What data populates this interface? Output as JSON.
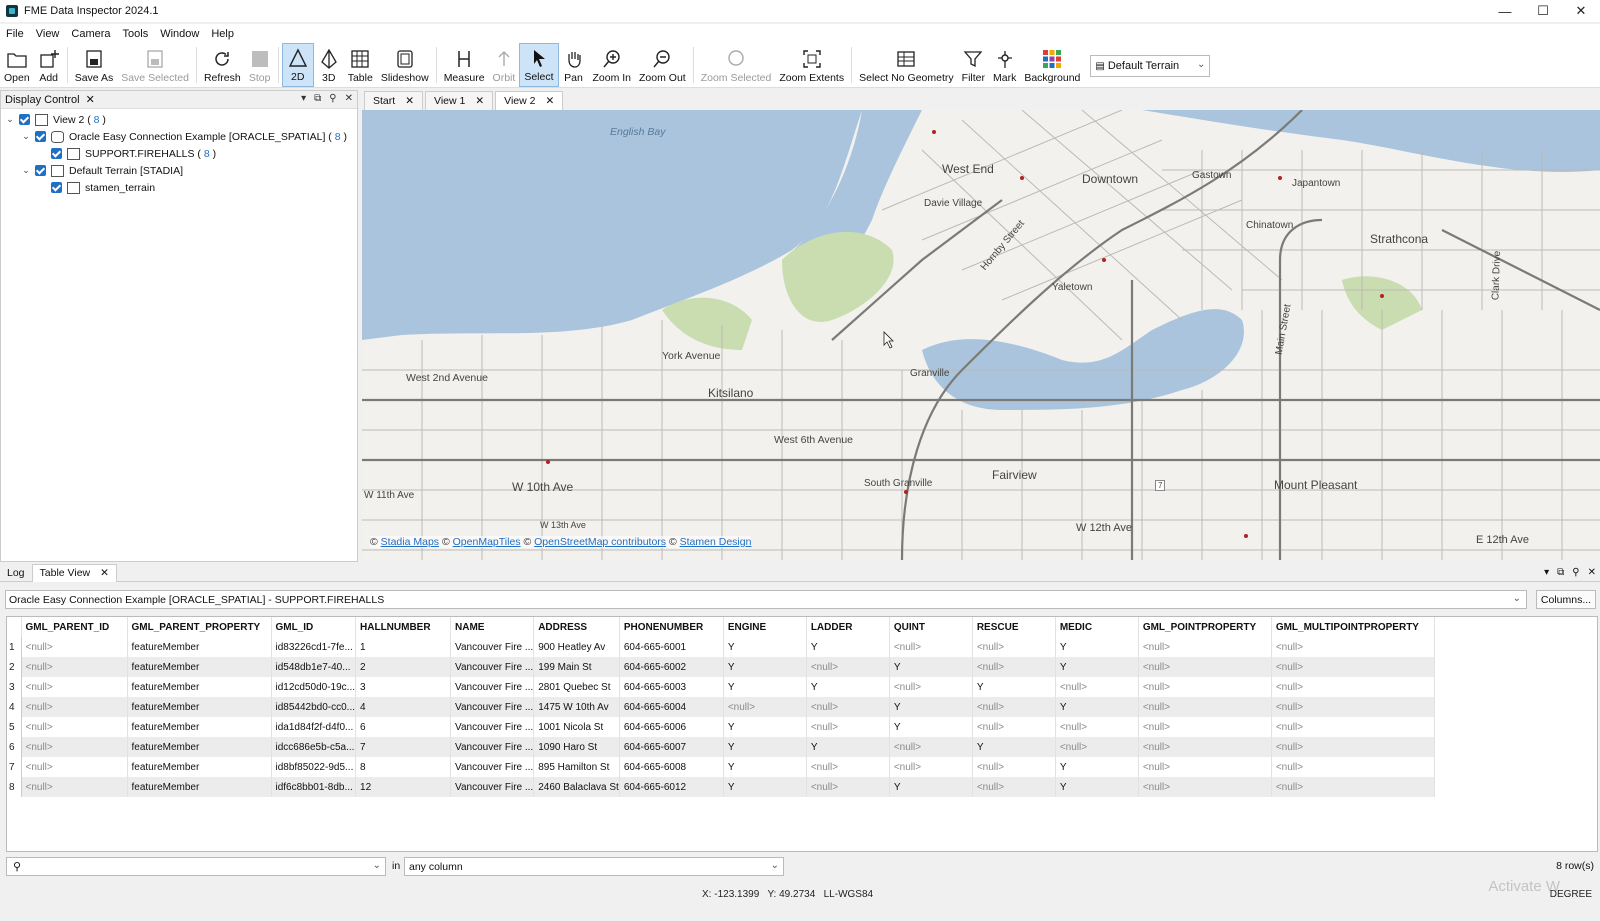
{
  "window": {
    "title": "FME Data Inspector 2024.1"
  },
  "menu": [
    "File",
    "View",
    "Camera",
    "Tools",
    "Window",
    "Help"
  ],
  "toolbar": {
    "buttons": [
      {
        "label": "Open",
        "icon": "folder-icon",
        "disabled": false
      },
      {
        "label": "Add",
        "icon": "add-layer-icon",
        "disabled": false
      },
      {
        "label": "Save As",
        "icon": "save-as-icon",
        "disabled": false
      },
      {
        "label": "Save Selected",
        "icon": "save-selected-icon",
        "disabled": true
      },
      {
        "label": "Refresh",
        "icon": "refresh-icon",
        "disabled": false
      },
      {
        "label": "Stop",
        "icon": "stop-icon",
        "disabled": true
      },
      {
        "label": "2D",
        "icon": "2d-icon",
        "disabled": false,
        "active": true
      },
      {
        "label": "3D",
        "icon": "3d-icon",
        "disabled": false
      },
      {
        "label": "Table",
        "icon": "table-icon",
        "disabled": false
      },
      {
        "label": "Slideshow",
        "icon": "slideshow-icon",
        "disabled": false
      },
      {
        "label": "Measure",
        "icon": "measure-icon",
        "disabled": false
      },
      {
        "label": "Orbit",
        "icon": "orbit-icon",
        "disabled": true
      },
      {
        "label": "Select",
        "icon": "select-arrow-icon",
        "disabled": false,
        "active": true
      },
      {
        "label": "Pan",
        "icon": "pan-hand-icon",
        "disabled": false
      },
      {
        "label": "Zoom In",
        "icon": "zoom-in-icon",
        "disabled": false
      },
      {
        "label": "Zoom Out",
        "icon": "zoom-out-icon",
        "disabled": false
      },
      {
        "label": "Zoom Selected",
        "icon": "zoom-selected-icon",
        "disabled": true
      },
      {
        "label": "Zoom Extents",
        "icon": "zoom-extents-icon",
        "disabled": false
      },
      {
        "label": "Select No Geometry",
        "icon": "select-no-geometry-icon",
        "disabled": false
      },
      {
        "label": "Filter",
        "icon": "filter-icon",
        "disabled": false
      },
      {
        "label": "Mark",
        "icon": "mark-icon",
        "disabled": false
      },
      {
        "label": "Background",
        "icon": "background-grid-icon",
        "disabled": false
      }
    ],
    "terrain_select": "Default Terrain"
  },
  "display_control": {
    "title": "Display Control",
    "tree": [
      {
        "label": "View 2",
        "count": "8",
        "level": 0,
        "icon": "view-icon"
      },
      {
        "label": "Oracle Easy Connection Example [ORACLE_SPATIAL]",
        "count": "8",
        "level": 1,
        "icon": "database-icon"
      },
      {
        "label": "SUPPORT.FIREHALLS",
        "count": "8",
        "level": 2,
        "icon": "table-layer-icon"
      },
      {
        "label": "Default Terrain [STADIA]",
        "count": "",
        "level": 1,
        "icon": "terrain-icon"
      },
      {
        "label": "stamen_terrain",
        "count": "",
        "level": 2,
        "icon": "table-layer-icon"
      }
    ]
  },
  "view_tabs": [
    "Start",
    "View 1",
    "View 2"
  ],
  "map": {
    "labels": [
      "English Bay",
      "West End",
      "Downtown",
      "Davie Village",
      "Gastown",
      "Japantown",
      "Chinatown",
      "Strathcona",
      "Hornby Street",
      "Yaletown",
      "York Avenue",
      "West 2nd Avenue",
      "Kitsilano",
      "Granville",
      "West 6th Avenue",
      "Fairview",
      "South Granville",
      "W 10th Ave",
      "W 11th Ave",
      "W 13th Ave",
      "W 12th Ave",
      "Main Street",
      "Mount Pleasant",
      "E 12th Ave",
      "Clark Drive",
      "7"
    ],
    "attribution": {
      "prefix": "©",
      "stadia": "Stadia Maps",
      "openmaptiles": "OpenMapTiles",
      "osm": "OpenStreetMap contributors",
      "stamen": "Stamen Design",
      "sep": "©"
    }
  },
  "lower_tabs": [
    "Log",
    "Table View"
  ],
  "table_view": {
    "feature_type": "Oracle Easy Connection Example [ORACLE_SPATIAL] - SUPPORT.FIREHALLS",
    "columns_button": "Columns...",
    "headers": [
      "GML_PARENT_ID",
      "GML_PARENT_PROPERTY",
      "GML_ID",
      "HALLNUMBER",
      "NAME",
      "ADDRESS",
      "PHONENUMBER",
      "ENGINE",
      "LADDER",
      "QUINT",
      "RESCUE",
      "MEDIC",
      "GML_POINTPROPERTY",
      "GML_MULTIPOINTPROPERTY"
    ],
    "rows": [
      [
        "<null>",
        "featureMember",
        "id83226cd1-7fe...",
        "1",
        "Vancouver Fire ...",
        "900 Heatley Av",
        "604-665-6001",
        "Y",
        "Y",
        "<null>",
        "<null>",
        "Y",
        "<null>",
        "<null>"
      ],
      [
        "<null>",
        "featureMember",
        "id548db1e7-40...",
        "2",
        "Vancouver Fire ...",
        "199 Main St",
        "604-665-6002",
        "Y",
        "<null>",
        "Y",
        "<null>",
        "Y",
        "<null>",
        "<null>"
      ],
      [
        "<null>",
        "featureMember",
        "id12cd50d0-19c...",
        "3",
        "Vancouver Fire ...",
        "2801 Quebec St",
        "604-665-6003",
        "Y",
        "Y",
        "<null>",
        "Y",
        "<null>",
        "<null>",
        "<null>"
      ],
      [
        "<null>",
        "featureMember",
        "id85442bd0-cc0...",
        "4",
        "Vancouver Fire ...",
        "1475 W 10th Av",
        "604-665-6004",
        "<null>",
        "<null>",
        "Y",
        "<null>",
        "Y",
        "<null>",
        "<null>"
      ],
      [
        "<null>",
        "featureMember",
        "ida1d84f2f-d4f0...",
        "6",
        "Vancouver Fire ...",
        "1001 Nicola St",
        "604-665-6006",
        "Y",
        "<null>",
        "Y",
        "<null>",
        "<null>",
        "<null>",
        "<null>"
      ],
      [
        "<null>",
        "featureMember",
        "idcc686e5b-c5a...",
        "7",
        "Vancouver Fire ...",
        "1090 Haro St",
        "604-665-6007",
        "Y",
        "Y",
        "<null>",
        "Y",
        "<null>",
        "<null>",
        "<null>"
      ],
      [
        "<null>",
        "featureMember",
        "id8bf85022-9d5...",
        "8",
        "Vancouver Fire ...",
        "895 Hamilton St",
        "604-665-6008",
        "Y",
        "<null>",
        "<null>",
        "<null>",
        "Y",
        "<null>",
        "<null>"
      ],
      [
        "<null>",
        "featureMember",
        "idf6c8bb01-8db...",
        "12",
        "Vancouver Fire ...",
        "2460 Balaclava St",
        "604-665-6012",
        "Y",
        "<null>",
        "Y",
        "<null>",
        "Y",
        "<null>",
        "<null>"
      ]
    ],
    "search_in_label": "in",
    "search_column": "any column",
    "row_count": "8 row(s)"
  },
  "status": {
    "x_label": "X:",
    "x": "-123.1399",
    "y_label": "Y:",
    "y": "49.2734",
    "crs": "LL-WGS84",
    "unit": "DEGREE",
    "watermark": "Activate W"
  }
}
